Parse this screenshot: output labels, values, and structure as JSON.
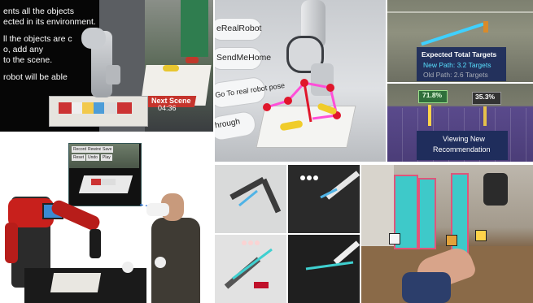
{
  "panel_a": {
    "lines": [
      "ents all the objects",
      "ected in its environment.",
      "ll the objects are c",
      "o, add any",
      "to the scene.",
      "robot will be able"
    ],
    "next_scene": "Next Scene",
    "timer": "04:36"
  },
  "panel_b": {
    "menu": [
      "eRealRobot",
      "SendMeHome",
      "Go To real robot pose",
      "hrough"
    ]
  },
  "panel_c": {
    "title": "Expected Total Targets",
    "new_path": "New Path: 3.2 Targets",
    "old_path": "Old Path: 2.6 Targets"
  },
  "panel_d": {
    "left_pct": "71.8%",
    "right_pct": "35.3%",
    "caption_line1": "Viewing New",
    "caption_line2": "Recommendation"
  },
  "panel_e": {
    "thumb_rows": [
      [
        "Record",
        "Rewind",
        "Save"
      ],
      [
        "Reset",
        "Undo",
        "Play"
      ]
    ]
  },
  "colors": {
    "unity_gray": "#4a4d52",
    "baxter_red": "#c8201c",
    "floor_purple": "#5a4a8c",
    "hud_blue": "#1f2d5c",
    "teal_panel": "#3ec9c9"
  }
}
